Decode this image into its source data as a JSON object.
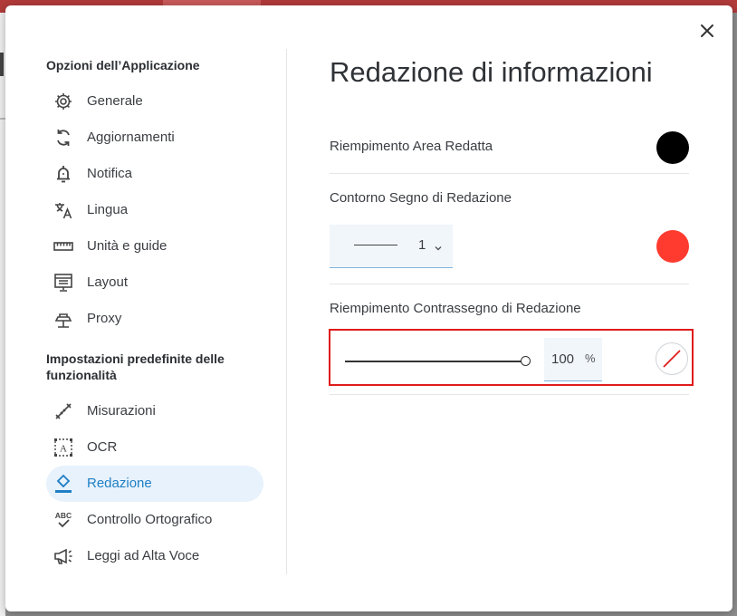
{
  "colors": {
    "accent": "#1f7fc4",
    "fill_black": "#000000",
    "outline_red": "#ff3b2f",
    "highlight_border": "#e01b1b"
  },
  "sidebar": {
    "group1_title": "Opzioni dell’Applicazione",
    "group1_items": [
      {
        "label": "Generale",
        "icon": "gear-icon"
      },
      {
        "label": "Aggiornamenti",
        "icon": "sync-icon"
      },
      {
        "label": "Notifica",
        "icon": "bell-icon"
      },
      {
        "label": "Lingua",
        "icon": "translate-icon"
      },
      {
        "label": "Unità e guide",
        "icon": "ruler-icon"
      },
      {
        "label": "Layout",
        "icon": "layout-icon"
      },
      {
        "label": "Proxy",
        "icon": "proxy-icon"
      }
    ],
    "group2_title": "Impostazioni predefinite delle funzionalità",
    "group2_items": [
      {
        "label": "Misurazioni",
        "icon": "measure-icon"
      },
      {
        "label": "OCR",
        "icon": "ocr-icon"
      },
      {
        "label": "Redazione",
        "icon": "eraser-icon",
        "active": true
      },
      {
        "label": "Controllo Ortografico",
        "icon": "spellcheck-icon"
      },
      {
        "label": "Leggi ad Alta Voce",
        "icon": "megaphone-icon"
      }
    ]
  },
  "main": {
    "title": "Redazione di informazioni",
    "fill_label": "Riempimento Area Redatta",
    "outline_label": "Contorno Segno di Redazione",
    "stroke_width": "1",
    "mark_fill_label": "Riempimento Contrassegno di Redazione",
    "opacity_value": "100",
    "opacity_unit": "%"
  }
}
